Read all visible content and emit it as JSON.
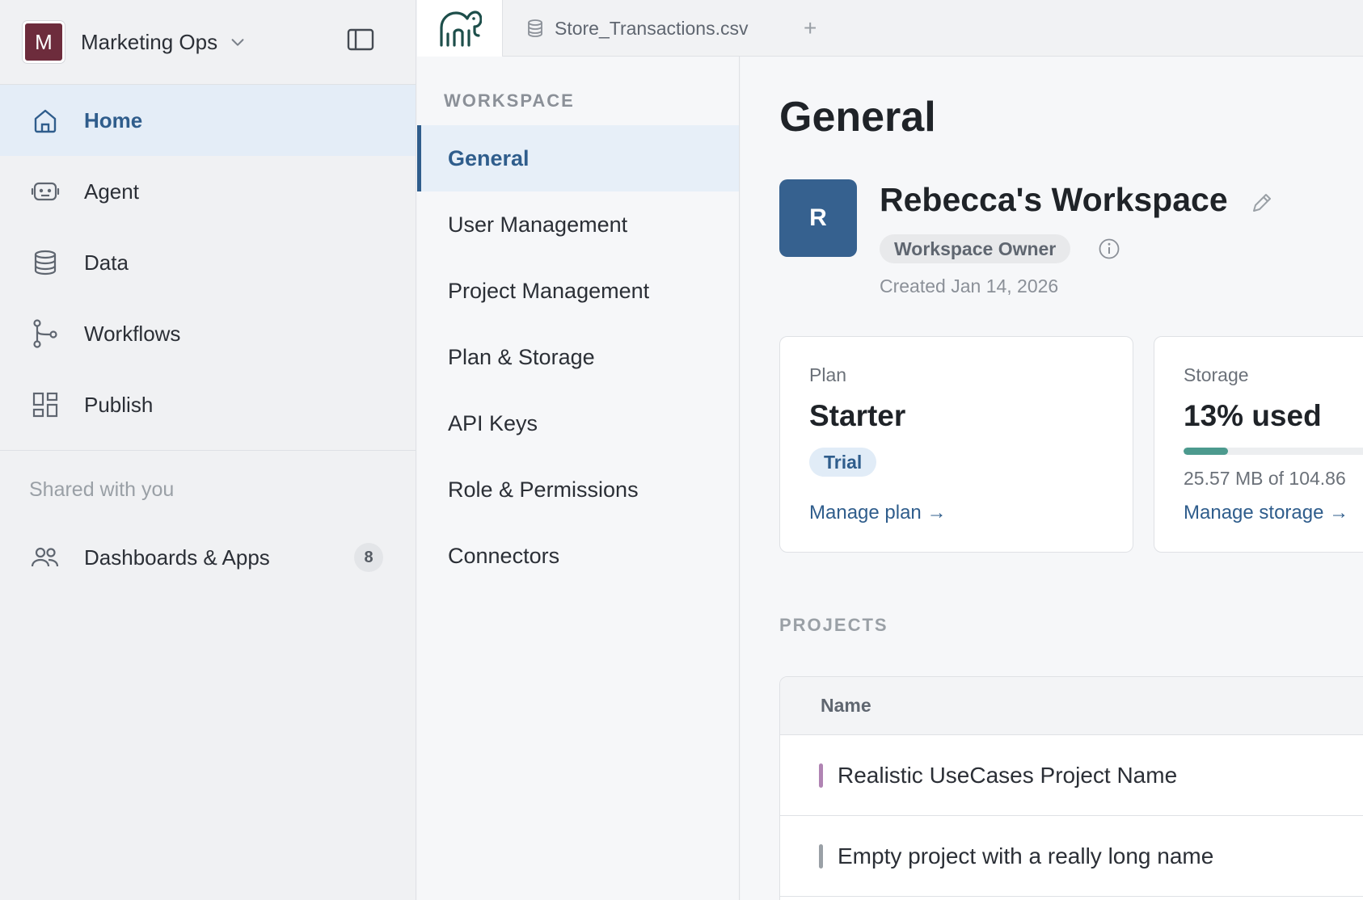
{
  "workspace_switcher": {
    "initial": "M",
    "name": "Marketing Ops",
    "avatar_color": "#6d2c3c"
  },
  "nav": {
    "items": [
      {
        "label": "Home",
        "icon": "home-icon",
        "active": true
      },
      {
        "label": "Agent",
        "icon": "robot-icon",
        "active": false
      },
      {
        "label": "Data",
        "icon": "database-icon",
        "active": false
      },
      {
        "label": "Workflows",
        "icon": "workflow-icon",
        "active": false
      },
      {
        "label": "Publish",
        "icon": "dashboard-grid-icon",
        "active": false
      }
    ],
    "shared_title": "Shared with you",
    "shared_items": [
      {
        "label": "Dashboards & Apps",
        "icon": "users-icon",
        "count": "8"
      }
    ]
  },
  "tabs": {
    "logo": "elephant-logo-icon",
    "file_tab": {
      "label": "Store_Transactions.csv",
      "icon": "database-icon"
    },
    "add_label": "+"
  },
  "settings_nav": {
    "title": "WORKSPACE",
    "items": [
      "General",
      "User Management",
      "Project Management",
      "Plan & Storage",
      "API Keys",
      "Role & Permissions",
      "Connectors"
    ],
    "active": "General"
  },
  "main": {
    "title": "General",
    "workspace": {
      "initial": "R",
      "name": "Rebecca's Workspace",
      "role": "Workspace Owner",
      "created": "Created Jan 14, 2026"
    },
    "plan_card": {
      "label": "Plan",
      "value": "Starter",
      "badge": "Trial",
      "link": "Manage plan →"
    },
    "storage_card": {
      "label": "Storage",
      "value": "13% used",
      "used_fraction": 0.13,
      "detail": "25.57 MB of 104.86",
      "link": "Manage storage →"
    },
    "projects": {
      "title": "PROJECTS",
      "column_name": "Name",
      "rows": [
        {
          "name": "Realistic UseCases Project Name",
          "color": "#b084b3"
        },
        {
          "name": "Empty project with a really long name",
          "color": "#9aa0a6"
        }
      ]
    }
  },
  "colors": {
    "accent": "#2f5d8c",
    "progress": "#4c9a8e",
    "avatar_blue": "#36618f"
  }
}
